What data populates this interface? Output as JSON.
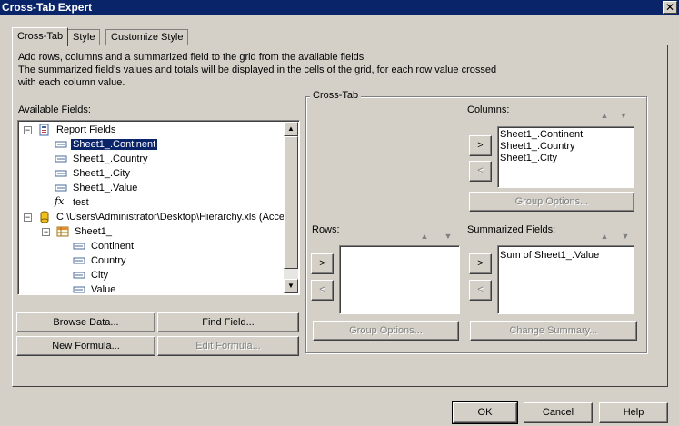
{
  "window": {
    "title": "Cross-Tab Expert",
    "close_glyph": "✕"
  },
  "tabs": [
    {
      "label": "Cross-Tab"
    },
    {
      "label": "Style"
    },
    {
      "label": "Customize Style"
    }
  ],
  "description": {
    "line1": "Add rows, columns and a summarized field to the grid from the available fields",
    "line2": "The summarized field's values and totals will be displayed in the cells of the grid, for each row value crossed",
    "line3": "with each column value."
  },
  "available_fields": {
    "label": "Available Fields:",
    "tree": {
      "report_fields": "Report Fields",
      "items": [
        "Sheet1_.Continent",
        "Sheet1_.Country",
        "Sheet1_.City",
        "Sheet1_.Value"
      ],
      "formula": "test",
      "datasource": "C:\\Users\\Administrator\\Desktop\\Hierarchy.xls (Acces",
      "table": "Sheet1_",
      "table_fields": [
        "Continent",
        "Country",
        "City",
        "Value"
      ]
    },
    "selected": "Sheet1_.Continent"
  },
  "left_buttons": {
    "browse": "Browse Data...",
    "find": "Find Field...",
    "new_formula": "New Formula...",
    "edit_formula": "Edit Formula..."
  },
  "crosstab": {
    "group_title": "Cross-Tab",
    "columns_label": "Columns:",
    "columns": [
      "Sheet1_.Continent",
      "Sheet1_.Country",
      "Sheet1_.City"
    ],
    "rows_label": "Rows:",
    "rows": [],
    "summarized_label": "Summarized Fields:",
    "summarized": [
      "Sum of Sheet1_.Value"
    ],
    "group_options": "Group Options...",
    "change_summary": "Change Summary...",
    "add_glyph": ">",
    "remove_glyph": "<",
    "up_glyph": "▲",
    "down_glyph": "▼"
  },
  "footer": {
    "ok": "OK",
    "cancel": "Cancel",
    "help": "Help"
  }
}
